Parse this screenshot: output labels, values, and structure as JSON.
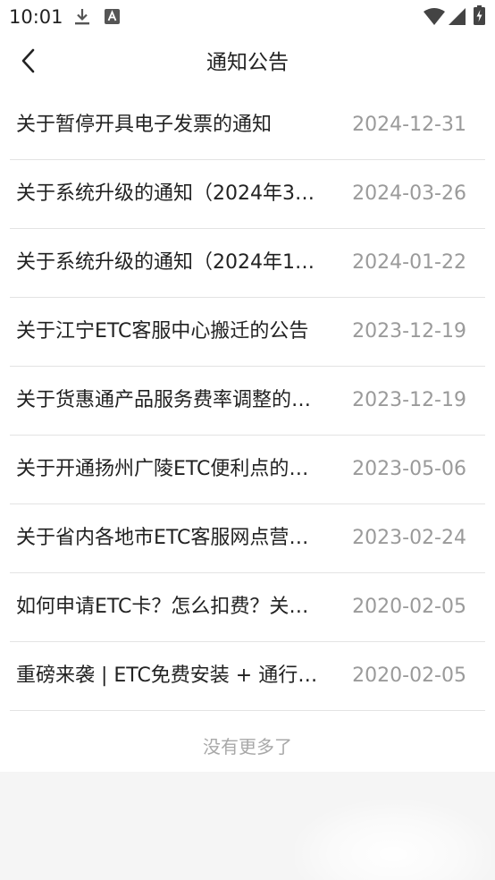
{
  "status_bar": {
    "time": "10:01",
    "icons": [
      "download-icon",
      "font-a-icon",
      "wifi-icon",
      "signal-icon",
      "battery-charging-icon"
    ]
  },
  "header": {
    "back_icon": "chevron-left-icon",
    "title": "通知公告"
  },
  "notices": [
    {
      "title": "关于暂停开具电子发票的通知",
      "date": "2024-12-31"
    },
    {
      "title": "关于系统升级的通知（2024年3…",
      "date": "2024-03-26"
    },
    {
      "title": "关于系统升级的通知（2024年1…",
      "date": "2024-01-22"
    },
    {
      "title": "关于江宁ETC客服中心搬迁的公告",
      "date": "2023-12-19"
    },
    {
      "title": "关于货惠通产品服务费率调整的…",
      "date": "2023-12-19"
    },
    {
      "title": "关于开通扬州广陵ETC便利点的…",
      "date": "2023-05-06"
    },
    {
      "title": "关于省内各地市ETC客服网点营…",
      "date": "2023-02-24"
    },
    {
      "title": "如何申请ETC卡？怎么扣费？关…",
      "date": "2020-02-05"
    },
    {
      "title": "重磅来袭 | ETC免费安装 + 通行…",
      "date": "2020-02-05"
    }
  ],
  "footer": {
    "no_more_text": "没有更多了"
  }
}
